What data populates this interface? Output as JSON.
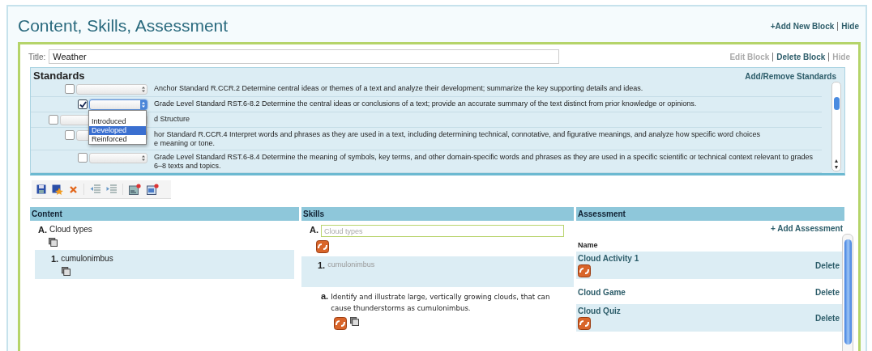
{
  "header": {
    "title": "Content, Skills, Assessment",
    "links": [
      "+Add New Block",
      "Hide"
    ]
  },
  "block": {
    "title_label": "Title:",
    "title_value": "Weather",
    "actions": [
      {
        "label": "Edit Block",
        "disabled": true
      },
      {
        "label": "Delete Block",
        "disabled": false
      },
      {
        "label": "Hide",
        "disabled": true
      }
    ]
  },
  "standards": {
    "heading": "Standards",
    "action": "Add/Remove Standards",
    "rows": [
      {
        "kind": "anchor",
        "checked": false,
        "text": "Anchor Standard R.CCR.2 Determine central ideas or themes of a text and analyze their development; summarize the key supporting details and ideas.",
        "children": [
          {
            "kind": "grade",
            "checked": true,
            "text": "Grade Level Standard RST.6-8.2 Determine the central ideas or conclusions of a text; provide an accurate summary of the text distinct from prior knowledge or opinions.",
            "options": [
              {
                "label": "Introduced",
                "selected": false
              },
              {
                "label": "Developed",
                "selected": true
              },
              {
                "label": "Reinforced",
                "selected": false
              }
            ]
          }
        ]
      },
      {
        "kind": "domain",
        "checked": false,
        "text": "d Structure",
        "children": [
          {
            "kind": "anchor",
            "checked": false,
            "text": "hor Standard R.CCR.4 Interpret words and phrases as they are used in a text, including determining technical, connotative, and figurative meanings, and analyze how specific word choices",
            "text_2": "e meaning or tone.",
            "children": [
              {
                "kind": "grade",
                "checked": false,
                "text": "Grade Level Standard RST.6-8.4 Determine the meaning of symbols, key terms, and other domain-specific words and phrases as they are used in a specific scientific or technical context relevant to grades 6–8 texts and topics."
              }
            ]
          }
        ]
      }
    ]
  },
  "columns": [
    "Content",
    "Skills",
    "Assessment"
  ],
  "content": [
    {
      "marker": "A.",
      "text": "Cloud types",
      "children": [
        {
          "marker": "1.",
          "text": "cumulonimbus"
        }
      ]
    }
  ],
  "skills": {
    "marker": "A.",
    "placeholder": "Cloud types",
    "children": [
      {
        "marker": "1.",
        "text": "cumulonimbus",
        "children": [
          {
            "marker": "a.",
            "text": "Identify and illustrate large, vertically growing clouds, that can cause thunderstorms as cumulonimbus."
          }
        ]
      }
    ]
  },
  "assessment": {
    "add": "+ Add Assessment",
    "name_heading": "Name",
    "rows": [
      {
        "name": "Cloud Activity 1",
        "linked": true,
        "action": "Delete"
      },
      {
        "name": "Cloud Game",
        "linked": false,
        "action": "Delete"
      },
      {
        "name": "Cloud Quiz",
        "linked": true,
        "action": "Delete"
      }
    ]
  }
}
